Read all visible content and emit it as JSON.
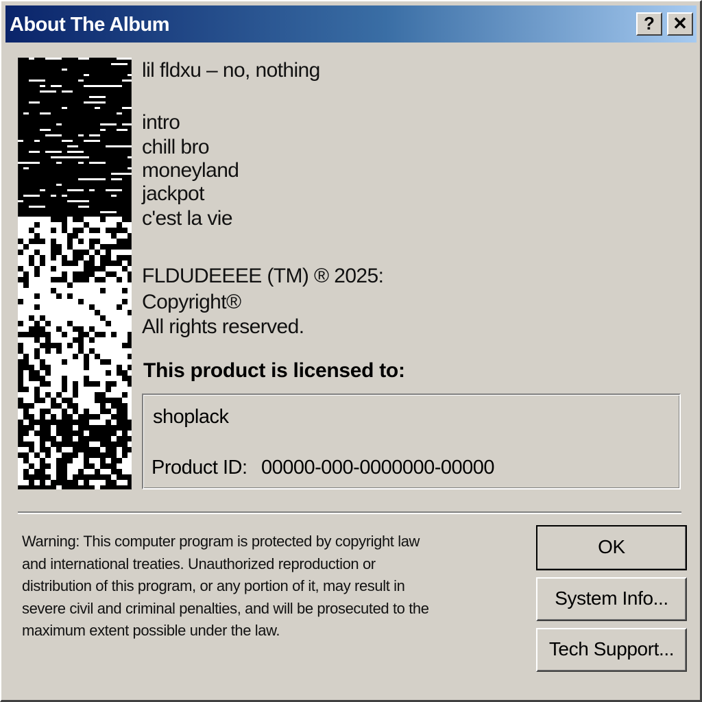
{
  "window": {
    "title": "About The Album",
    "help_label": "?",
    "close_label": "✕"
  },
  "album": {
    "artist_title": "lil fldxu – no, nothing",
    "tracks": [
      "intro",
      "chill bro",
      "moneyland",
      "jackpot",
      "c'est la vie"
    ]
  },
  "copyright": {
    "line1": "FLDUDEEEE (TM) ® 2025:",
    "line2": "Copyright®",
    "line3": "All rights reserved."
  },
  "license": {
    "heading": "This product is licensed to:",
    "licensee": "shoplack",
    "product_id_label": "Product ID:",
    "product_id_value": "00000-000-0000000-00000"
  },
  "warning": {
    "lines": [
      "Warning: This computer program is protected by copyright law",
      "and international treaties. Unauthorized reproduction or",
      "distribution of this program, or any portion of it, may result in",
      "severe civil and criminal penalties, and will be prosecuted to the",
      "maximum extent possible under the law."
    ]
  },
  "buttons": {
    "ok": "OK",
    "system_info": "System Info...",
    "tech_support": "Tech Support..."
  },
  "colors": {
    "dialog_bg": "#d4d0c8",
    "titlebar_start": "#0a246a",
    "titlebar_end": "#a6caf0",
    "album_art_bg": "#000000"
  }
}
